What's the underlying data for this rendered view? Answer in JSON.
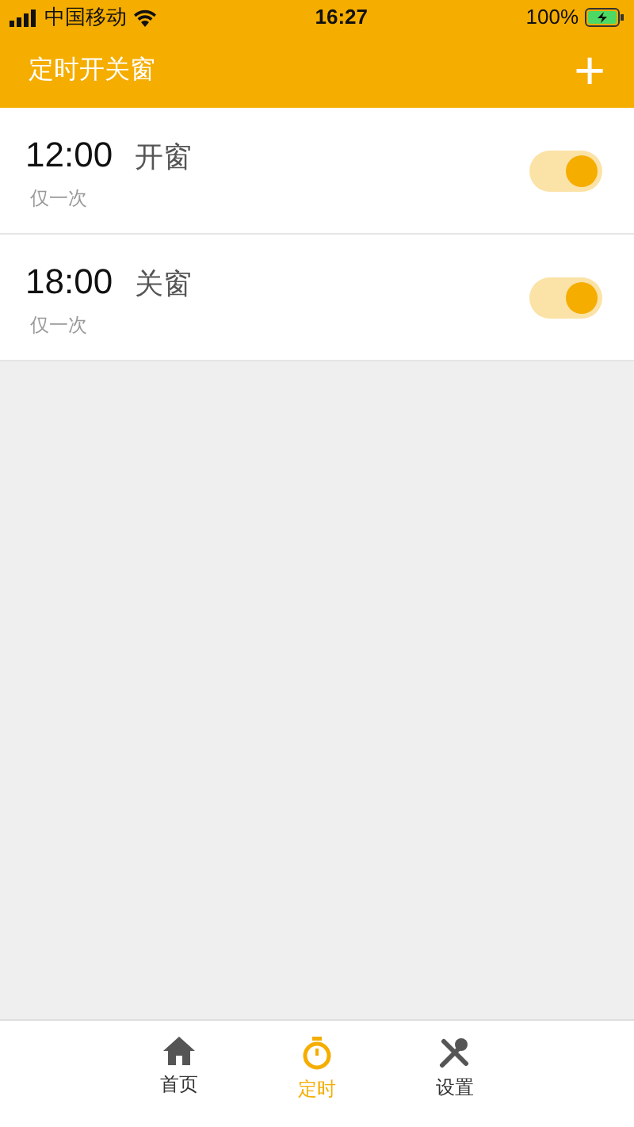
{
  "status_bar": {
    "carrier": "中国移动",
    "time": "16:27",
    "battery": "100%"
  },
  "header": {
    "title": "定时开关窗",
    "add": "+"
  },
  "timers": [
    {
      "time": "12:00",
      "action": "开窗",
      "repeat": "仅一次",
      "on": true
    },
    {
      "time": "18:00",
      "action": "关窗",
      "repeat": "仅一次",
      "on": true
    }
  ],
  "tabs": [
    {
      "label": "首页",
      "kind": "home",
      "selected": false
    },
    {
      "label": "定时",
      "kind": "timer",
      "selected": true
    },
    {
      "label": "设置",
      "kind": "settings",
      "selected": false
    }
  ]
}
